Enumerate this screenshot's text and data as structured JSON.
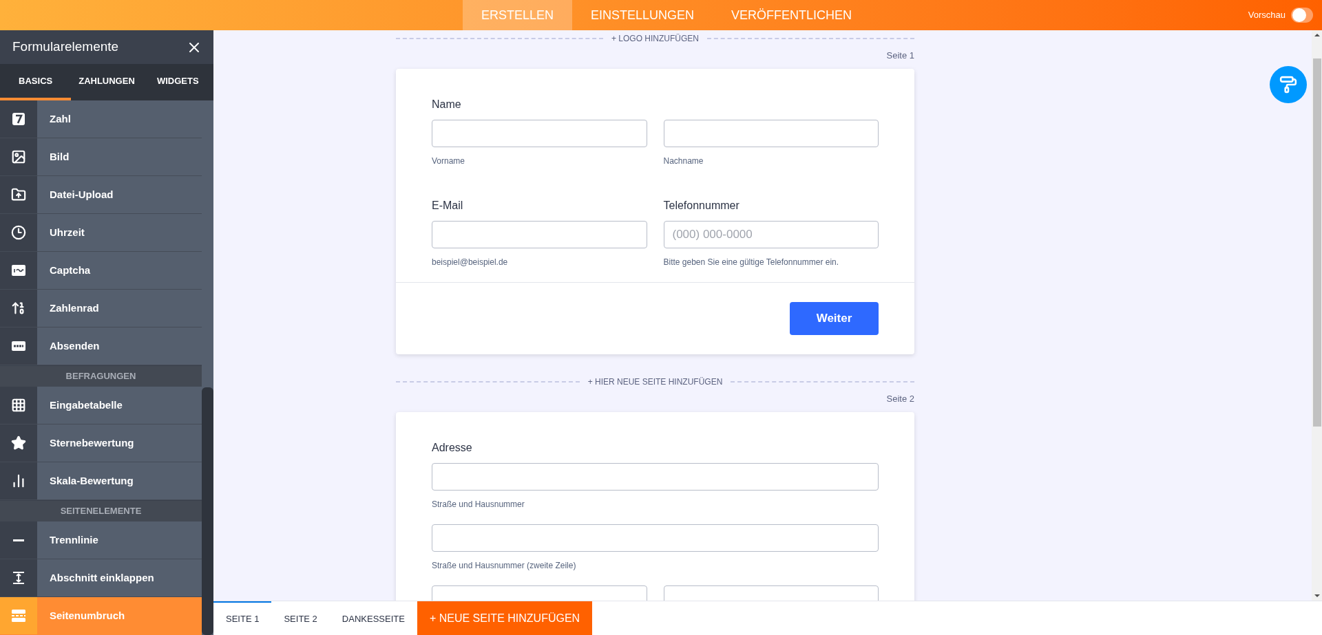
{
  "topbar": {
    "tabs": [
      {
        "label": "ERSTELLEN",
        "selected": true
      },
      {
        "label": "EINSTELLUNGEN",
        "selected": false
      },
      {
        "label": "VERÖFFENTLICHEN",
        "selected": false
      }
    ],
    "preview": {
      "label": "Vorschau",
      "on": false
    }
  },
  "sidebar": {
    "title": "Formularelemente",
    "tabs": [
      {
        "label": "BASICS",
        "selected": true
      },
      {
        "label": "ZAHLUNGEN",
        "selected": false
      },
      {
        "label": "WIDGETS",
        "selected": false
      }
    ],
    "items": [
      {
        "kind": "element",
        "label": "Zahl",
        "selected": false
      },
      {
        "kind": "element",
        "label": "Bild",
        "selected": false
      },
      {
        "kind": "element",
        "label": "Datei-Upload",
        "selected": false
      },
      {
        "kind": "element",
        "label": "Uhrzeit",
        "selected": false
      },
      {
        "kind": "element",
        "label": "Captcha",
        "selected": false
      },
      {
        "kind": "element",
        "label": "Zahlenrad",
        "selected": false
      },
      {
        "kind": "element",
        "label": "Absenden",
        "selected": false
      },
      {
        "kind": "section",
        "label": "BEFRAGUNGEN"
      },
      {
        "kind": "element",
        "label": "Eingabetabelle",
        "selected": false
      },
      {
        "kind": "element",
        "label": "Sternebewertung",
        "selected": false
      },
      {
        "kind": "element",
        "label": "Skala-Bewertung",
        "selected": false
      },
      {
        "kind": "section",
        "label": "SEITENELEMENTE"
      },
      {
        "kind": "element",
        "label": "Trennlinie",
        "selected": false
      },
      {
        "kind": "element",
        "label": "Abschnitt einklappen",
        "selected": false
      },
      {
        "kind": "element",
        "label": "Seitenumbruch",
        "selected": true
      }
    ]
  },
  "canvas": {
    "add_logo": "+ LOGO HINZUFÜGEN",
    "add_page": "+ HIER NEUE SEITE HINZUFÜGEN",
    "pages": [
      {
        "label": "Seite 1",
        "button": "Weiter",
        "rows": [
          {
            "kind": "group",
            "label": "Name",
            "inputs": [
              {
                "kind": "text",
                "sublabel": "Vorname"
              },
              {
                "kind": "text",
                "sublabel": "Nachname"
              }
            ]
          },
          {
            "kind": "columns",
            "columns": [
              {
                "label": "E-Mail",
                "sublabel": "beispiel@beispiel.de"
              },
              {
                "label": "Telefonnummer",
                "placeholder": "(000) 000-0000",
                "sublabel": "Bitte geben Sie eine gültige Telefonnummer ein."
              }
            ]
          }
        ]
      },
      {
        "label": "Seite 2",
        "rows": [
          {
            "kind": "group",
            "label": "Adresse",
            "inputs": [
              {
                "kind": "text",
                "sublabel": "Straße und Hausnummer"
              }
            ]
          },
          {
            "kind": "group",
            "inputs": [
              {
                "kind": "text",
                "sublabel": "Straße und Hausnummer (zweite Zeile)"
              }
            ]
          },
          {
            "kind": "group",
            "inputs": [
              {
                "kind": "text"
              },
              {
                "kind": "text"
              }
            ]
          }
        ]
      }
    ]
  },
  "page_tabs": {
    "tabs": [
      {
        "label": "SEITE 1",
        "selected": true
      },
      {
        "label": "SEITE 2",
        "selected": false
      },
      {
        "label": "DANKESSEITE",
        "selected": false
      }
    ],
    "add_button": "+ NEUE SEITE HINZUFÜGEN"
  }
}
